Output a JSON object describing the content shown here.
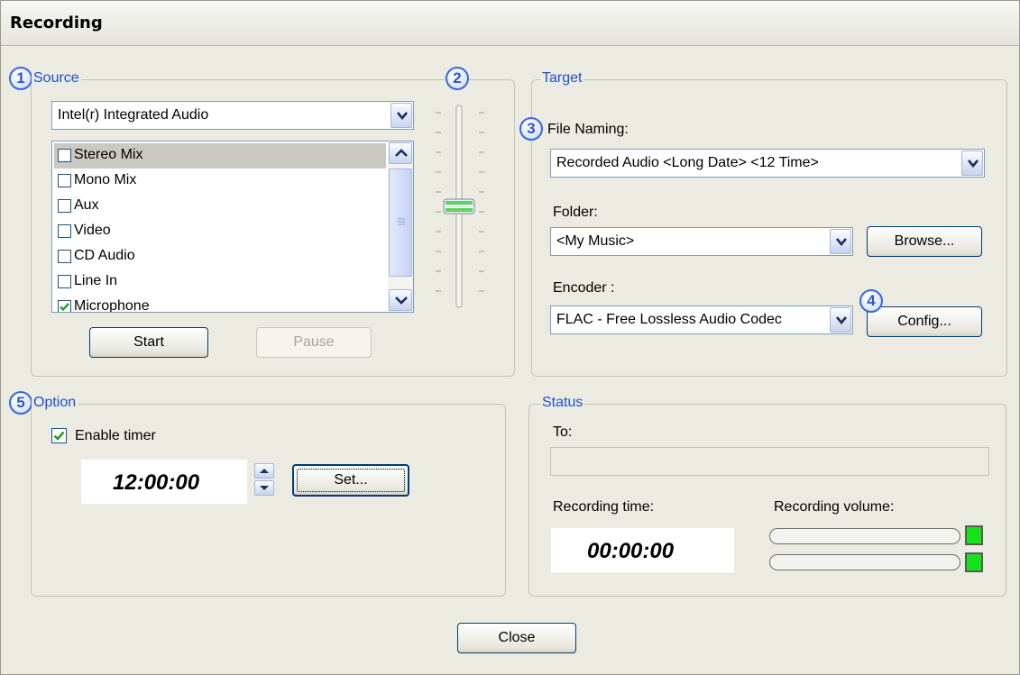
{
  "window": {
    "title": "Recording"
  },
  "source": {
    "legend": "Source",
    "badge": "1",
    "device": "Intel(r) Integrated Audio",
    "items": [
      {
        "label": "Stereo Mix",
        "checked": false,
        "selected": true
      },
      {
        "label": "Mono Mix",
        "checked": false
      },
      {
        "label": "Aux",
        "checked": false
      },
      {
        "label": "Video",
        "checked": false
      },
      {
        "label": "CD Audio",
        "checked": false
      },
      {
        "label": "Line In",
        "checked": false
      },
      {
        "label": "Microphone",
        "checked": true
      }
    ],
    "start_label": "Start",
    "pause_label": "Pause"
  },
  "volume": {
    "badge": "2"
  },
  "target": {
    "legend": "Target",
    "file_naming_badge": "3",
    "file_naming_label": "File Naming:",
    "file_naming_value": "Recorded Audio <Long Date> <12 Time>",
    "folder_label": "Folder:",
    "folder_value": "<My Music>",
    "browse_label": "Browse...",
    "encoder_label": "Encoder :",
    "encoder_value": "FLAC - Free Lossless Audio Codec",
    "config_badge": "4",
    "config_label": "Config..."
  },
  "option": {
    "legend": "Option",
    "badge": "5",
    "enable_timer_label": "Enable timer",
    "enable_timer_checked": true,
    "timer_value": "12:00:00",
    "set_label": "Set..."
  },
  "status": {
    "legend": "Status",
    "to_label": "To:",
    "to_value": "",
    "recording_time_label": "Recording time:",
    "recording_time_value": "00:00:00",
    "recording_volume_label": "Recording volume:",
    "led_color": "#16e21c"
  },
  "close_label": "Close"
}
